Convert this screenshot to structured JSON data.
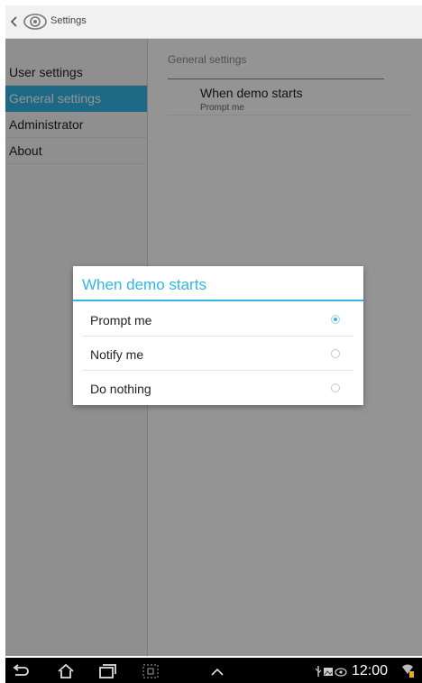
{
  "app_bar": {
    "title": "Settings",
    "back_icon": "back-chevron-icon",
    "app_icon": "eye-logo-icon"
  },
  "sidebar": {
    "items": [
      {
        "label": "User settings",
        "selected": false
      },
      {
        "label": "General settings",
        "selected": true
      },
      {
        "label": "Administrator",
        "selected": false
      },
      {
        "label": "About",
        "selected": false
      }
    ]
  },
  "content": {
    "section_header": "General settings",
    "preference": {
      "title": "When demo starts",
      "summary": "Prompt me"
    }
  },
  "dialog": {
    "title": "When demo starts",
    "options": [
      {
        "label": "Prompt me",
        "checked": true
      },
      {
        "label": "Notify me",
        "checked": false
      },
      {
        "label": "Do nothing",
        "checked": false
      }
    ]
  },
  "nav_bar": {
    "icons": [
      "back-icon",
      "home-icon",
      "recent-apps-icon",
      "screenshot-icon",
      "up-chevron-icon"
    ],
    "status_icons": [
      "usb-icon",
      "image-icon",
      "eye-icon",
      "signal-icon"
    ],
    "clock": "12:00"
  },
  "colors": {
    "accent": "#33b5e5",
    "navbar": "#000000",
    "dim": "rgba(0,0,0,0.42)"
  }
}
